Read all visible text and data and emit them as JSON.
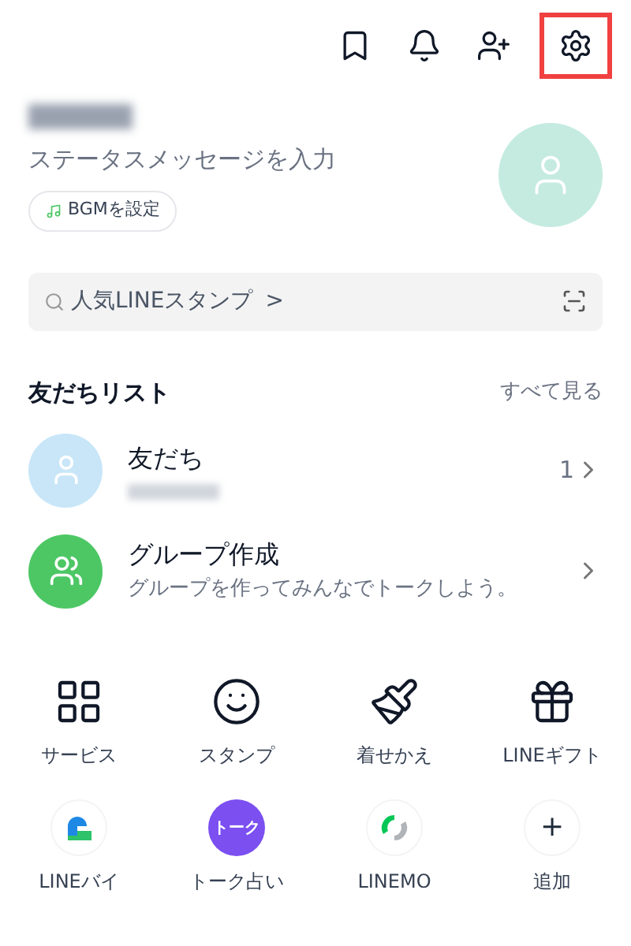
{
  "header": {
    "actions": [
      {
        "kind": "bookmark",
        "highlighted": false
      },
      {
        "kind": "bell",
        "highlighted": false
      },
      {
        "kind": "add-friend",
        "highlighted": false
      },
      {
        "kind": "settings",
        "highlighted": true
      }
    ]
  },
  "profile": {
    "status_placeholder": "ステータスメッセージを入力",
    "bgm_button": "BGMを設定"
  },
  "search": {
    "placeholder": "人気LINEスタンプ",
    "chevron": ">"
  },
  "friends_section": {
    "title": "友だちリスト",
    "see_all": "すべて見る",
    "rows": [
      {
        "kind": "friends",
        "title": "友だち",
        "count": "1"
      },
      {
        "kind": "group",
        "title": "グループ作成",
        "subtitle": "グループを作ってみんなでトークしよう。"
      }
    ]
  },
  "services": [
    {
      "kind": "grid",
      "label": "サービス"
    },
    {
      "kind": "smile",
      "label": "スタンプ"
    },
    {
      "kind": "brush",
      "label": "着せかえ"
    },
    {
      "kind": "gift",
      "label": "LINEギフト"
    },
    {
      "kind": "baito",
      "label": "LINEバイ"
    },
    {
      "kind": "talk",
      "label": "トーク占い",
      "logo_text": "トーク"
    },
    {
      "kind": "linemo",
      "label": "LINEMO"
    },
    {
      "kind": "add",
      "label": "追加",
      "glyph": "+"
    }
  ]
}
